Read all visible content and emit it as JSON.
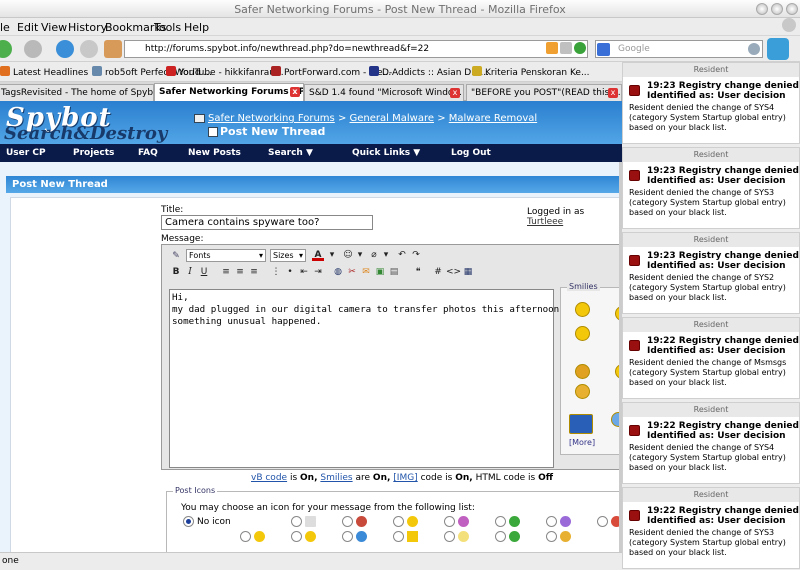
{
  "window": {
    "title": "Safer Networking Forums - Post New Thread - Mozilla Firefox"
  },
  "menu": [
    "le",
    "Edit",
    "View",
    "History",
    "Bookmarks",
    "Tools",
    "Help"
  ],
  "nav": {
    "url": "http://forums.spybot.info/newthread.php?do=newthread&f=22",
    "search_placeholder": "Google"
  },
  "bookmarks": [
    {
      "label": "Latest Headlines",
      "color": "#e07020"
    },
    {
      "label": "rob5oft Perfect World ...",
      "color": "#6688aa"
    },
    {
      "label": "YouTube - hikkifanrau...",
      "color": "#cc2222"
    },
    {
      "label": "PortForward.com - Fre...",
      "color": "#aa2222"
    },
    {
      "label": "D-Addicts :: Asian Dra...",
      "color": "#223388"
    },
    {
      "label": "Kriteria Penskoran Ke...",
      "color": "#ccaa22"
    }
  ],
  "tabs": [
    {
      "label": "TagsRevisited - The home of Spyb..."
    },
    {
      "label": "Safer Networking Forums - P..."
    },
    {
      "label": "S&D 1.4 found \"Microsoft Windo..."
    },
    {
      "label": "\"BEFORE you POST\"(READ this ..."
    }
  ],
  "site": {
    "logo_top": "Spybot",
    "logo_bottom": "Search&Destroy",
    "crumb1": "Safer Networking Forums",
    "crumb_sep": ">",
    "crumb2": "General Malware",
    "crumb3": "Malware Removal",
    "current": "Post New Thread"
  },
  "navrow": [
    "User CP",
    "Projects",
    "FAQ",
    "New Posts",
    "Search ▼",
    "Quick Links ▼",
    "Log Out"
  ],
  "form": {
    "panel_title": "Post New Thread",
    "title_label": "Title:",
    "title_value": "Camera contains spyware too?",
    "logged_in_prefix": "Logged in as",
    "username": "Turtleee",
    "message_label": "Message:",
    "font_select": "Fonts",
    "size_select": "Sizes",
    "message": "Hi,\nmy dad plugged in our digital camera to transfer photos this afternoon and\nsomething unusual happened.",
    "smilies_label": "Smilies",
    "more_label": "[More]",
    "code_vb": "vB code",
    "code_is1": "is",
    "code_on1": "On,",
    "code_smilies": "Smilies",
    "code_are": "are",
    "code_on2": "On,",
    "code_img": "[IMG]",
    "code_is2": "code is",
    "code_on3": "On,",
    "code_html": "HTML code is",
    "code_off": "Off",
    "post_icons_label": "Post Icons",
    "post_icons_text": "You may choose an icon for your message from the following list:",
    "no_icon": "No icon"
  },
  "status": "one",
  "notifications": [
    {
      "header": "Resident",
      "title1": "19:23 Registry change denied",
      "title2": "Identified as: User decision",
      "body": "Resident denied the change of SYS4 (category System Startup global entry) based on your black list."
    },
    {
      "header": "Resident",
      "title1": "19:23 Registry change denied",
      "title2": "Identified as: User decision",
      "body": "Resident denied the change of SYS3 (category System Startup global entry) based on your black list."
    },
    {
      "header": "Resident",
      "title1": "19:23 Registry change denied",
      "title2": "Identified as: User decision",
      "body": "Resident denied the change of SYS2 (category System Startup global entry) based on your black list."
    },
    {
      "header": "Resident",
      "title1": "19:22 Registry change denied",
      "title2": "Identified as: User decision",
      "body": "Resident denied the change of Msmsgs (category System Startup global entry) based on your black list."
    },
    {
      "header": "Resident",
      "title1": "19:22 Registry change denied",
      "title2": "Identified as: User decision",
      "body": "Resident denied the change of SYS4 (category System Startup global entry) based on your black list."
    },
    {
      "header": "Resident",
      "title1": "19:22 Registry change denied",
      "title2": "Identified as: User decision",
      "body": "Resident denied the change of SYS3 (category System Startup global entry) based on your black list."
    }
  ]
}
